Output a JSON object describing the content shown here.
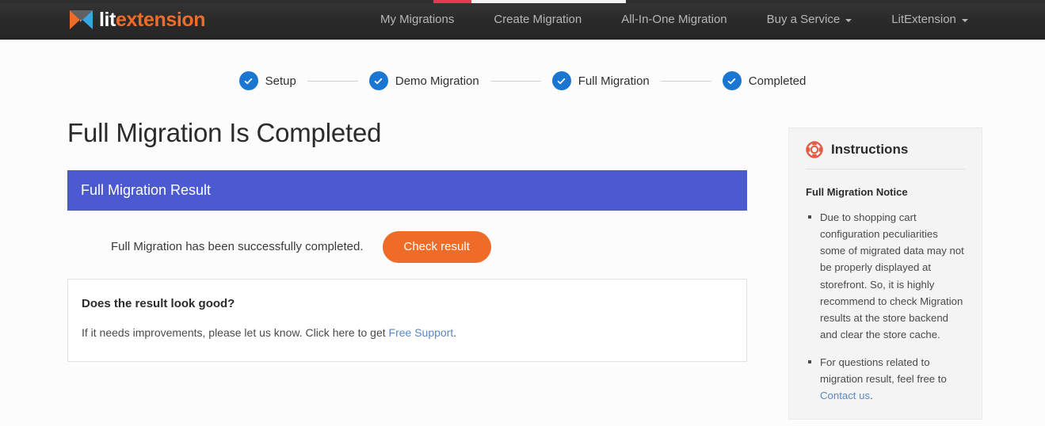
{
  "loader": {
    "segment_color_active": "#e8384f",
    "segment_color_trail": "#f2f2f2"
  },
  "navbar": {
    "logo": {
      "icon": "litextension-bowtie-icon",
      "text_primary": "lit",
      "text_secondary": "extension",
      "color_primary": "#ffffff",
      "color_secondary": "#ef6c28"
    },
    "background": "#2b2b2b",
    "items": [
      {
        "label": "My Migrations",
        "has_caret": false
      },
      {
        "label": "Create Migration",
        "has_caret": false
      },
      {
        "label": "All-In-One Migration",
        "has_caret": false
      },
      {
        "label": "Buy a Service",
        "has_caret": true
      },
      {
        "label": "LitExtension",
        "has_caret": true
      }
    ]
  },
  "stepper": {
    "active_color": "#1b76d2",
    "steps": [
      {
        "label": "Setup",
        "state": "completed",
        "icon": "check-icon"
      },
      {
        "label": "Demo Migration",
        "state": "completed",
        "icon": "check-icon"
      },
      {
        "label": "Full Migration",
        "state": "completed",
        "icon": "check-icon"
      },
      {
        "label": "Completed",
        "state": "completed",
        "icon": "check-icon"
      }
    ]
  },
  "main": {
    "page_title": "Full Migration Is Completed",
    "result_panel": {
      "header": "Full Migration Result",
      "header_color": "#4c5ad1",
      "message": "Full Migration has been successfully completed.",
      "button_label": "Check result",
      "button_color": "#ef6c28"
    },
    "feedback": {
      "title": "Does the result look good?",
      "text_before": "If it needs improvements, please let us know. Click here to get ",
      "link_label": "Free Support",
      "text_after": "."
    }
  },
  "sidebar": {
    "icon": "lifebuoy-icon",
    "icon_color": "#e35b45",
    "title": "Instructions",
    "subtitle": "Full Migration Notice",
    "notices": [
      {
        "text": "Due to shopping cart configuration peculiarities some of migrated data may not be properly displayed at storefront. So, it is highly recommend to check Migration results at the store backend and clear the store cache.",
        "link_label": null,
        "text_after": null
      },
      {
        "text": "For questions related to migration result, feel free to ",
        "link_label": "Contact us",
        "text_after": "."
      }
    ]
  }
}
